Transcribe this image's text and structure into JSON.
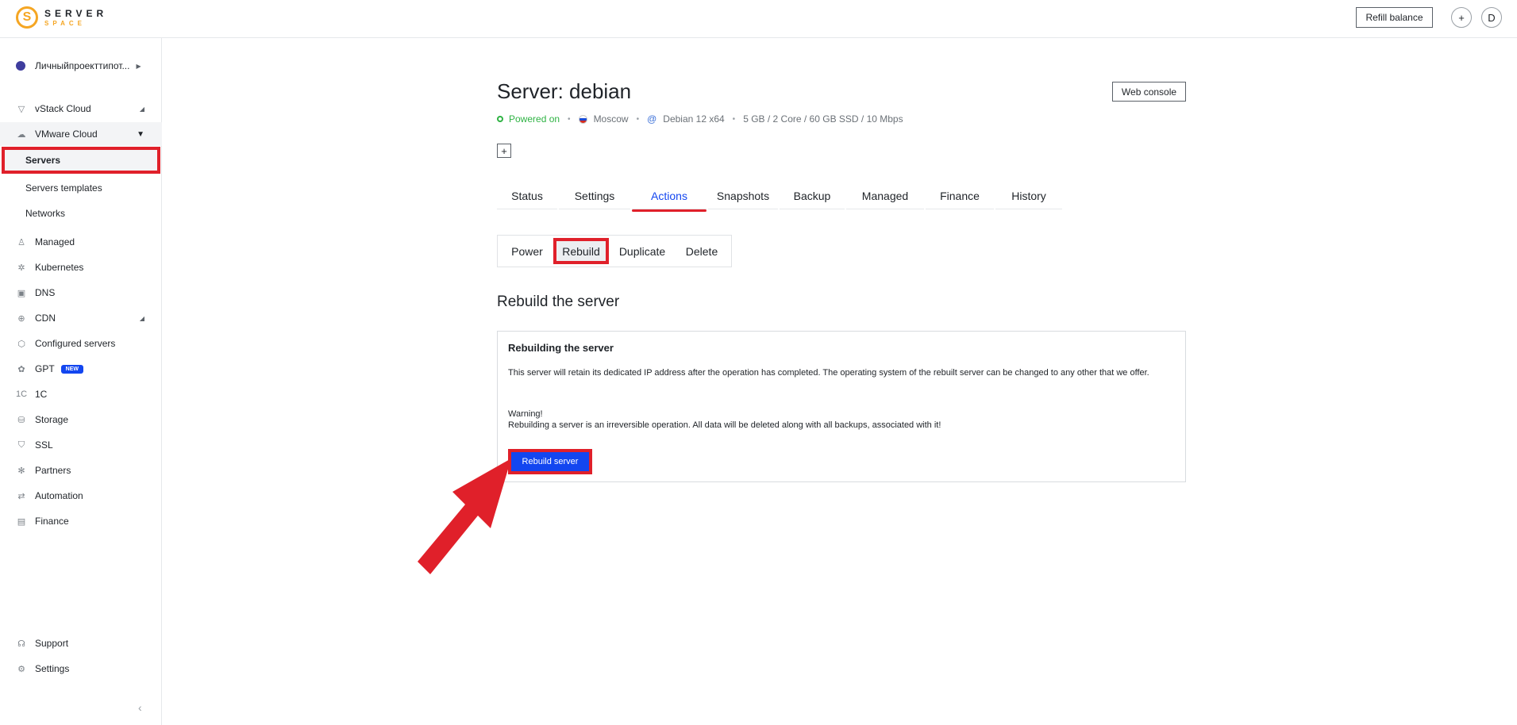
{
  "header": {
    "logo_line1": "SERVER",
    "logo_line2": "SPACE",
    "logo_mark": "S",
    "refill_label": "Refill balance",
    "add_label": "+",
    "avatar_initial": "D"
  },
  "sidebar": {
    "project_name": "Личныйпроекттипот...",
    "items": [
      {
        "label": "vStack Cloud",
        "icon": "vstack-icon"
      },
      {
        "label": "VMware Cloud",
        "icon": "cloud-icon"
      },
      {
        "label": "Managed",
        "icon": "managed-icon"
      },
      {
        "label": "Kubernetes",
        "icon": "kubernetes-icon"
      },
      {
        "label": "DNS",
        "icon": "dns-icon"
      },
      {
        "label": "CDN",
        "icon": "globe-icon"
      },
      {
        "label": "Configured servers",
        "icon": "configured-icon"
      },
      {
        "label": "GPT",
        "icon": "gpt-icon",
        "badge": "NEW"
      },
      {
        "label": "1C",
        "icon": "onec-icon"
      },
      {
        "label": "Storage",
        "icon": "storage-icon"
      },
      {
        "label": "SSL",
        "icon": "shield-icon"
      },
      {
        "label": "Partners",
        "icon": "partners-icon"
      },
      {
        "label": "Automation",
        "icon": "automation-icon"
      },
      {
        "label": "Finance",
        "icon": "finance-icon"
      }
    ],
    "sub_items": [
      {
        "label": "Servers"
      },
      {
        "label": "Servers templates"
      },
      {
        "label": "Networks"
      }
    ],
    "bottom": [
      {
        "label": "Support",
        "icon": "headset-icon"
      },
      {
        "label": "Settings",
        "icon": "gear-icon"
      }
    ]
  },
  "server": {
    "title": "Server: debian",
    "web_console_label": "Web console",
    "status": "Powered on",
    "location": "Moscow",
    "os": "Debian 12 x64",
    "specs": "5 GB / 2 Core / 60 GB SSD / 10 Mbps"
  },
  "tabs": [
    {
      "label": "Status"
    },
    {
      "label": "Settings"
    },
    {
      "label": "Actions"
    },
    {
      "label": "Snapshots"
    },
    {
      "label": "Backup"
    },
    {
      "label": "Managed"
    },
    {
      "label": "Finance"
    },
    {
      "label": "History"
    }
  ],
  "actions_tabs": [
    {
      "label": "Power"
    },
    {
      "label": "Rebuild"
    },
    {
      "label": "Duplicate"
    },
    {
      "label": "Delete"
    }
  ],
  "rebuild": {
    "section_title": "Rebuild the server",
    "card_title": "Rebuilding the server",
    "description": "This server will retain its dedicated IP address after the operation has completed. The operating system of the rebuilt server can be changed to any other that we offer.",
    "warning_title": "Warning!",
    "warning_text": "Rebuilding a server is an irreversible operation. All data will be deleted along with all backups, associated with it!",
    "button_label": "Rebuild server"
  },
  "colors": {
    "accent": "#1346f0",
    "highlight": "#e0202a",
    "status_green": "#2fb344",
    "logo_orange": "#f5a623"
  }
}
